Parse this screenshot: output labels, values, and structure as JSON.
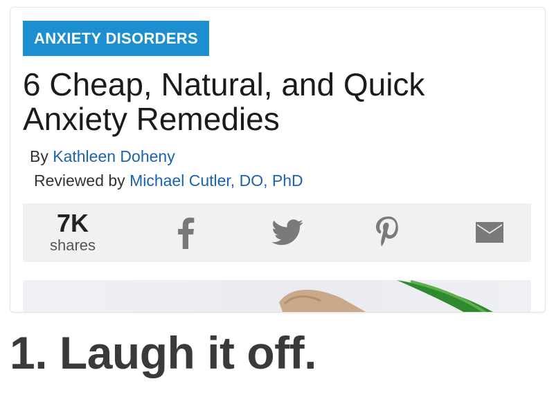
{
  "article": {
    "category": "ANXIETY DISORDERS",
    "title": "6 Cheap, Natural, and Quick Anxiety Remedies",
    "author_prefix": "By ",
    "author": "Kathleen Doheny",
    "reviewer_prefix": "Reviewed by ",
    "reviewer": "Michael Cutler, DO, PhD"
  },
  "share": {
    "count": "7K",
    "count_label": "shares",
    "icons": [
      "facebook-icon",
      "twitter-icon",
      "pinterest-icon",
      "email-icon"
    ]
  },
  "section": {
    "heading": "1. Laugh it off."
  },
  "colors": {
    "category_bg": "#1d8fd1",
    "link": "#1a63b0",
    "share_bar_bg": "#f1f1f1",
    "icon_gray": "#7a7a7a"
  }
}
